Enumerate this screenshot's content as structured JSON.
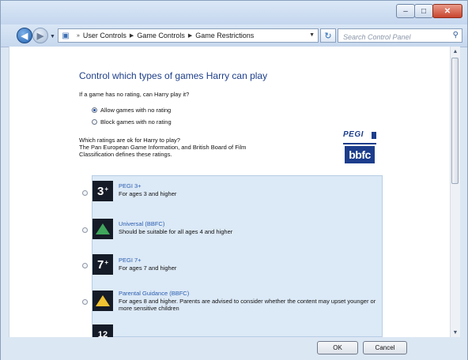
{
  "window": {
    "controls": {
      "minimize": "–",
      "maximize": "□",
      "close": "✕"
    }
  },
  "navigation": {
    "back_icon": "arrow-left-icon",
    "forward_icon": "arrow-right-icon",
    "breadcrumb": [
      "User Controls",
      "Game Controls",
      "Game Restrictions"
    ],
    "search_placeholder": "Search Control Panel"
  },
  "page": {
    "heading": "Control which types of games Harry can play",
    "no_rating_question": "If a game has no rating, can Harry play it?",
    "no_rating_options": [
      {
        "label": "Allow games with no rating",
        "checked": true
      },
      {
        "label": "Block games with no rating",
        "checked": false
      }
    ],
    "intro_lines": [
      "Which ratings are ok for Harry to play?",
      "The Pan European Game Information, and British Board of Film",
      "Classification defines these ratings."
    ],
    "logos": {
      "pegi": "PEGI",
      "bbfc": "bbfc"
    }
  },
  "ratings": [
    {
      "badge": "3",
      "badge_suffix": "+",
      "title": "PEGI 3+",
      "description": "For ages 3 and higher",
      "selected": false
    },
    {
      "badge": "",
      "title": "Universal (BBFC)",
      "description": "Should be suitable for all ages 4 and higher",
      "selected": false,
      "color": "#3fa65b"
    },
    {
      "badge": "7",
      "badge_suffix": "+",
      "title": "PEGI 7+",
      "description": "For ages 7 and higher",
      "selected": false
    },
    {
      "badge": "",
      "title": "Parental Guidance (BBFC)",
      "description": "For ages 8 and higher. Parents are advised to consider whether the content may upset younger or more sensitive children",
      "selected": false,
      "color": "#f1c232"
    },
    {
      "badge": "12",
      "badge_suffix": "",
      "title": "",
      "description": "",
      "selected": false
    }
  ],
  "footer": {
    "ok": "OK",
    "cancel": "Cancel"
  }
}
